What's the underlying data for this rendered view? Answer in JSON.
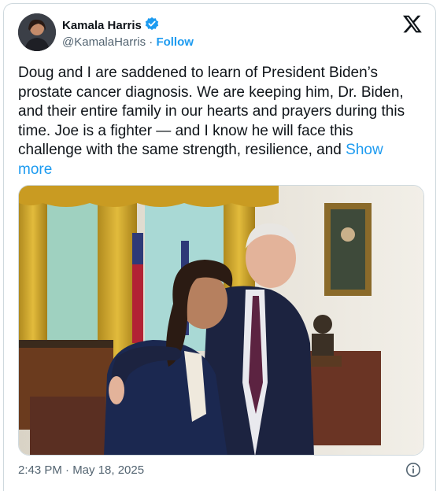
{
  "author": {
    "name": "Kamala Harris",
    "handle": "@KamalaHarris",
    "separator": "·",
    "follow_label": "Follow",
    "verified": true
  },
  "post": {
    "text": "Doug and I are saddened to learn of President Biden’s prostate cancer diagnosis. We are keeping him, Dr. Biden, and their entire family in our hearts and prayers during this time. Joe is a fighter — and I know he will face this challenge with the same strength, resilience, and",
    "show_more": "Show more"
  },
  "timestamp": "2:43 PM · May 18, 2025",
  "icons": {
    "brand": "x-logo-icon",
    "verified": "verified-badge-icon",
    "info": "info-icon"
  },
  "colors": {
    "link": "#1d9bf0",
    "text": "#0f1419",
    "secondary": "#536471",
    "border": "#cfd9de"
  }
}
